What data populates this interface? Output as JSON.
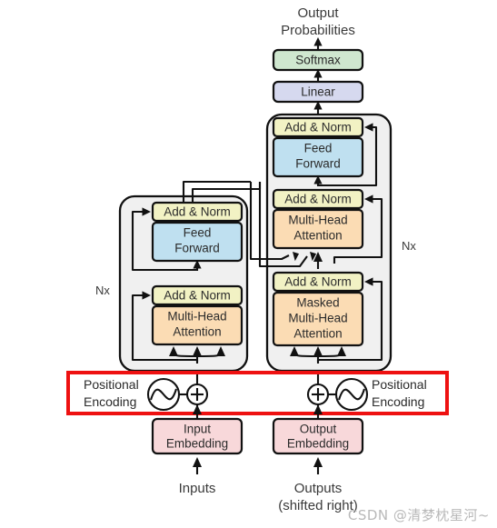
{
  "figure": {
    "title_top_line1": "Output",
    "title_top_line2": "Probabilities",
    "watermark": "CSDN @清梦枕星河~"
  },
  "colors": {
    "softmax": "#cfe7cf",
    "linear": "#d6d9ef",
    "add_norm": "#f2f2c4",
    "feed_forward": "#bfe0f0",
    "attention": "#fbdcb4",
    "embedding": "#f8d8da",
    "stack_fill": "#f0f0f0",
    "stroke": "#111111",
    "highlight": "#ee1111",
    "text": "#2b2b2b"
  },
  "output_head": {
    "softmax": "Softmax",
    "linear": "Linear"
  },
  "encoder": {
    "repeat_label": "Nx",
    "blocks": [
      {
        "name": "add-norm-top",
        "label": "Add & Norm"
      },
      {
        "name": "feed-forward",
        "label_line1": "Feed",
        "label_line2": "Forward"
      },
      {
        "name": "add-norm-bottom",
        "label": "Add & Norm"
      },
      {
        "name": "multi-head-attention",
        "label_line1": "Multi-Head",
        "label_line2": "Attention"
      }
    ]
  },
  "decoder": {
    "repeat_label": "Nx",
    "blocks": [
      {
        "name": "add-norm-top",
        "label": "Add & Norm"
      },
      {
        "name": "feed-forward",
        "label_line1": "Feed",
        "label_line2": "Forward"
      },
      {
        "name": "add-norm-middle",
        "label": "Add & Norm"
      },
      {
        "name": "multi-head-attention",
        "label_line1": "Multi-Head",
        "label_line2": "Attention"
      },
      {
        "name": "add-norm-bottom",
        "label": "Add & Norm"
      },
      {
        "name": "masked-multi-head-attention",
        "label_line1": "Masked",
        "label_line2": "Multi-Head",
        "label_line3": "Attention"
      }
    ]
  },
  "positional_encoding": {
    "left_line1": "Positional",
    "left_line2": "Encoding",
    "right_line1": "Positional",
    "right_line2": "Encoding",
    "operator": "+",
    "highlighted": true
  },
  "embeddings": {
    "input_line1": "Input",
    "input_line2": "Embedding",
    "output_line1": "Output",
    "output_line2": "Embedding"
  },
  "inputs": {
    "left": "Inputs",
    "right_line1": "Outputs",
    "right_line2": "(shifted right)"
  }
}
